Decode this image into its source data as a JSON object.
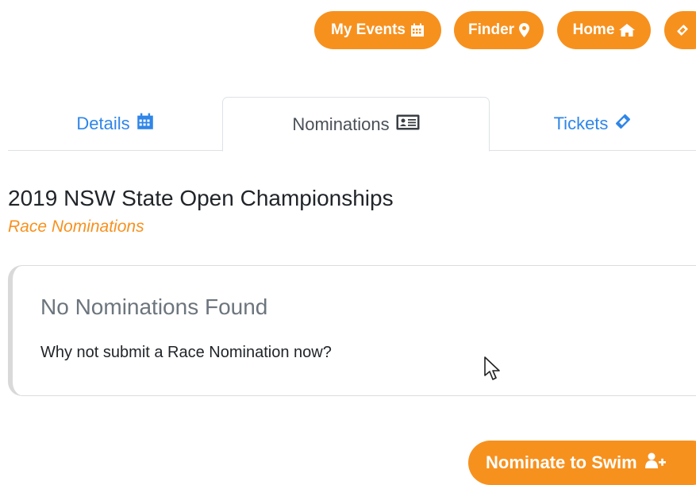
{
  "topnav": {
    "items": [
      {
        "label": "My Events",
        "icon": "calendar-icon"
      },
      {
        "label": "Finder",
        "icon": "map-marker-icon"
      },
      {
        "label": "Home",
        "icon": "home-icon"
      },
      {
        "label": "",
        "icon": "ticket-icon"
      }
    ]
  },
  "tabs": [
    {
      "label": "Details",
      "icon": "calendar-icon",
      "active": false
    },
    {
      "label": "Nominations",
      "icon": "id-card-icon",
      "active": true
    },
    {
      "label": "Tickets",
      "icon": "ticket-icon",
      "active": false
    }
  ],
  "event": {
    "title": "2019 NSW State Open Championships",
    "subtitle": "Race Nominations"
  },
  "notice": {
    "heading": "No Nominations Found",
    "body": "Why not submit a Race Nomination now?"
  },
  "actions": {
    "nominate_label": "Nominate to Swim",
    "nominate_icon": "user-plus-icon"
  },
  "colors": {
    "accent": "#f7911e",
    "link": "#2f86e8",
    "text": "#212529",
    "muted": "#6c757d",
    "border": "#dee2e6"
  }
}
